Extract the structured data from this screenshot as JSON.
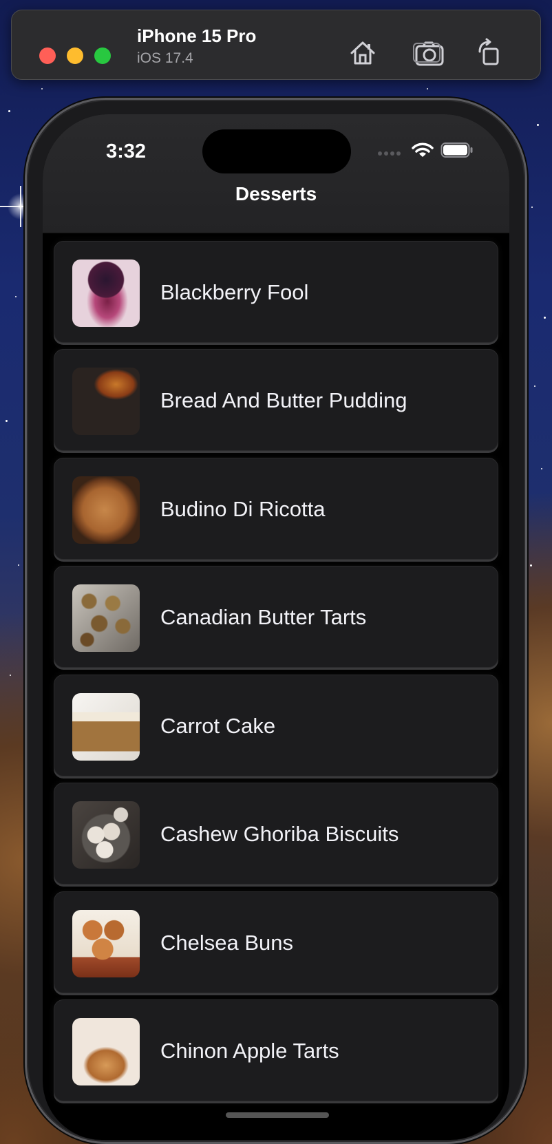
{
  "simulator": {
    "device_name": "iPhone 15 Pro",
    "os_version": "iOS 17.4",
    "home_button": "home-icon",
    "screenshot_button": "camera-icon",
    "rotate_button": "rotate-icon"
  },
  "status_bar": {
    "time": "3:32"
  },
  "nav": {
    "title": "Desserts"
  },
  "desserts": [
    {
      "name": "Blackberry Fool"
    },
    {
      "name": "Bread And Butter Pudding"
    },
    {
      "name": "Budino Di Ricotta"
    },
    {
      "name": "Canadian Butter Tarts"
    },
    {
      "name": "Carrot Cake"
    },
    {
      "name": "Cashew Ghoriba Biscuits"
    },
    {
      "name": "Chelsea Buns"
    },
    {
      "name": "Chinon Apple Tarts"
    }
  ],
  "colors": {
    "card_background": "#1c1c1e",
    "screen_background": "#000000",
    "text_primary": "#f2f2f7"
  }
}
